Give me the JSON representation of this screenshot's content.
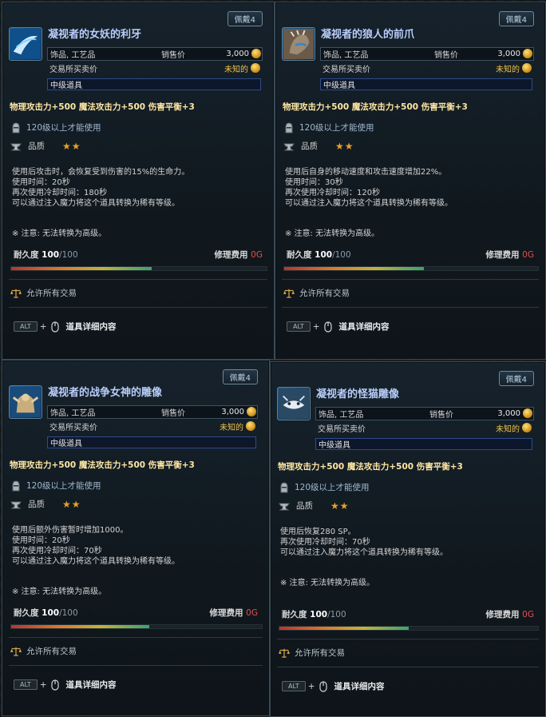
{
  "cards": [
    {
      "tag": "佩戴4",
      "title": "凝视者的女妖的利牙",
      "category": "饰品, 工艺品",
      "sell_label": "销售价",
      "sell_value": "3,000",
      "trade_label": "交易所买卖价",
      "trade_value": "未知的",
      "grade": "中级道具",
      "stats": "物理攻击力+500  魔法攻击力+500  伤害平衡+3",
      "level_req": "120级以上才能使用",
      "quality_label": "品质",
      "stars": "★★",
      "desc": [
        "使用后攻击时，会恢复受到伤害的15%的生命力。",
        "使用时间：20秒",
        "再次使用冷却时间：180秒",
        "可以通过注入魔力将这个道具转换为稀有等级。"
      ],
      "note": "※ 注意: 无法转换为高级。",
      "durability_label": "耐久度",
      "durability_current": "100",
      "durability_max": "/100",
      "durability_fraction": 0.55,
      "repair_label": "修理费用",
      "repair_value": "0G",
      "trade_allowed": "允许所有交易",
      "alt_key": "ALT",
      "alt_plus": "+",
      "alt_label": "道具详细内容"
    },
    {
      "tag": "佩戴4",
      "title": "凝视者的狼人的前爪",
      "category": "饰品, 工艺品",
      "sell_label": "销售价",
      "sell_value": "3,000",
      "trade_label": "交易所买卖价",
      "trade_value": "未知的",
      "grade": "中级道具",
      "stats": "物理攻击力+500  魔法攻击力+500  伤害平衡+3",
      "level_req": "120级以上才能使用",
      "quality_label": "品质",
      "stars": "★★",
      "desc": [
        "使用后自身的移动速度和攻击速度增加22%。",
        "使用时间：30秒",
        "再次使用冷却时间：120秒",
        "可以通过注入魔力将这个道具转换为稀有等级。"
      ],
      "note": "※ 注意: 无法转换为高级。",
      "durability_label": "耐久度",
      "durability_current": "100",
      "durability_max": "/100",
      "durability_fraction": 0.55,
      "repair_label": "修理费用",
      "repair_value": "0G",
      "trade_allowed": "允许所有交易",
      "alt_key": "ALT",
      "alt_plus": "+",
      "alt_label": "道具详细内容"
    },
    {
      "tag": "佩戴4",
      "title": "凝视者的战争女神的雕像",
      "category": "饰品, 工艺品",
      "sell_label": "销售价",
      "sell_value": "3,000",
      "trade_label": "交易所买卖价",
      "trade_value": "未知的",
      "grade": "中级道具",
      "stats": "物理攻击力+500  魔法攻击力+500  伤害平衡+3",
      "level_req": "120级以上才能使用",
      "quality_label": "品质",
      "stars": "★★",
      "desc": [
        "使用后额外伤害暂时增加1000。",
        "使用时间：20秒",
        "再次使用冷却时间：70秒",
        "可以通过注入魔力将这个道具转换为稀有等级。"
      ],
      "note": "※ 注意: 无法转换为高级。",
      "durability_label": "耐久度",
      "durability_current": "100",
      "durability_max": "/100",
      "durability_fraction": 0.55,
      "repair_label": "修理费用",
      "repair_value": "0G",
      "trade_allowed": "允许所有交易",
      "alt_key": "ALT",
      "alt_plus": "+",
      "alt_label": "道具详细内容"
    },
    {
      "tag": "佩戴4",
      "title": "凝视者的怪猫雕像",
      "category": "饰品, 工艺品",
      "sell_label": "销售价",
      "sell_value": "3,000",
      "trade_label": "交易所买卖价",
      "trade_value": "未知的",
      "grade": "中级道具",
      "stats": "物理攻击力+500  魔法攻击力+500  伤害平衡+3",
      "level_req": "120级以上才能使用",
      "quality_label": "品质",
      "stars": "★★",
      "desc": [
        "使用后恢复280 SP。",
        "再次使用冷却时间：70秒",
        "可以通过注入魔力将这个道具转换为稀有等级。"
      ],
      "note": "※ 注意: 无法转换为高级。",
      "durability_label": "耐久度",
      "durability_current": "100",
      "durability_max": "/100",
      "durability_fraction": 0.5,
      "repair_label": "修理费用",
      "repair_value": "0G",
      "trade_allowed": "允许所有交易",
      "alt_key": "ALT",
      "alt_plus": "+",
      "alt_label": "道具详细内容"
    }
  ],
  "icons": {
    "item_icons": [
      "banshee-fang-icon",
      "werewolf-claw-icon",
      "war-goddess-statue-icon",
      "cat-statue-icon"
    ],
    "coin": "gold-coin-icon",
    "level": "knight-helmet-icon",
    "quality": "anvil-icon",
    "trade": "scale-icon",
    "mouse": "mouse-icon"
  },
  "colors": {
    "title": "#b8cdfa",
    "stats": "#ffe7a3",
    "stars": "#e7a12a",
    "repair_value": "#e05050",
    "unknown_price": "#f1c24b"
  }
}
